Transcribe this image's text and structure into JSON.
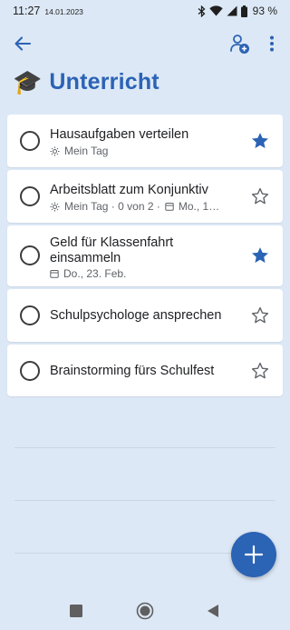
{
  "status_bar": {
    "time": "11:27",
    "date": "14.01.2023",
    "battery": "93 %",
    "icons": [
      "bluetooth-icon",
      "wifi-icon",
      "signal-icon",
      "battery-icon"
    ]
  },
  "toolbar": {
    "icons": [
      "back-arrow-icon",
      "share-person-add-icon",
      "more-vert-icon"
    ]
  },
  "list": {
    "emoji": "🎓",
    "title": "Unterricht"
  },
  "tasks": [
    {
      "title": "Hausaufgaben verteilen",
      "meta_myday": "Mein Tag",
      "important": true
    },
    {
      "title": "Arbeitsblatt zum Konjunktiv",
      "meta_myday": "Mein Tag · 0 von 2 ·",
      "meta_due": "Mo., 1…",
      "important": false
    },
    {
      "title_line1": "Geld für Klassenfahrt",
      "title_line2": "einsammeln",
      "meta_due": "Do., 23. Feb.",
      "important": true
    },
    {
      "title": "Schulpsychologe ansprechen",
      "important": false
    },
    {
      "title": "Brainstorming fürs Schulfest",
      "important": false
    }
  ],
  "colors": {
    "accent": "#2b63b5",
    "background": "#dde8f6",
    "card": "#ffffff",
    "star_filled": "#2b63b5"
  },
  "fab": {
    "icon": "plus-icon"
  },
  "nav_bar": {
    "icons": [
      "recents-square-icon",
      "home-circle-icon",
      "back-triangle-icon"
    ]
  }
}
